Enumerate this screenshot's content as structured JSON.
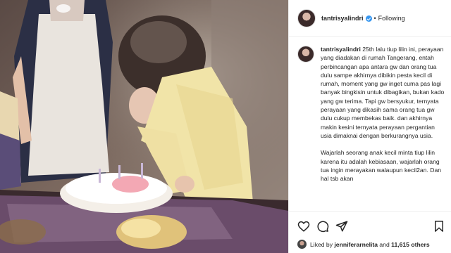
{
  "post": {
    "username": "tantrisyalindri",
    "separator": "•",
    "follow_status": "Following"
  },
  "caption": {
    "username": "tantrisyalindri",
    "paragraphs": [
      "25th lalu tiup lilin ini, perayaan yang diadakan di rumah Tangerang, entah perbincangan apa antara gw dan orang tua dulu sampe akhirnya dibikin pesta kecil di rumah, moment yang gw inget cuma pas lagi banyak bingkisin untuk dibagikan, bukan kado yang gw terima. Tapi gw bersyukur, ternyata perayaan yang dikasih sama orang tua gw dulu cukup membekas baik. dan akhirnya makin kesini ternyata perayaan pergantian usia dimaknai dengan berkurangnya usia.",
      "Wajarlah seorang anak kecil minta tiup lilin karena itu adalah kebiasaan, wajarlah orang tua ingin merayakan walaupun kecil2an. Dan hal tsb akan"
    ]
  },
  "likes": {
    "prefix": "Liked by",
    "user": "jenniferarnelita",
    "conjunction": "and",
    "count": "11,615 others"
  },
  "icons": {
    "like": "heart-icon",
    "comment": "comment-icon",
    "share": "share-icon",
    "save": "bookmark-icon"
  },
  "colors": {
    "verified": "#3897f0",
    "border": "#efefef",
    "text": "#262626"
  }
}
